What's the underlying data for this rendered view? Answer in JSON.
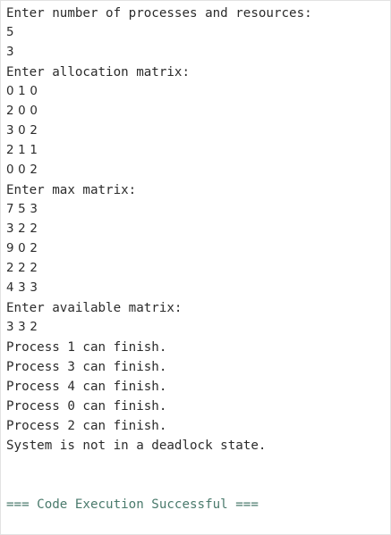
{
  "output": {
    "lines": [
      {
        "text": "Enter number of processes and resources:",
        "kind": "prompt"
      },
      {
        "text": "5",
        "kind": "nums"
      },
      {
        "text": "3",
        "kind": "nums"
      },
      {
        "text": "Enter allocation matrix:",
        "kind": "prompt"
      },
      {
        "text": "0 1 0",
        "kind": "nums"
      },
      {
        "text": "2 0 0",
        "kind": "nums"
      },
      {
        "text": "3 0 2",
        "kind": "nums"
      },
      {
        "text": "2 1 1",
        "kind": "nums"
      },
      {
        "text": "0 0 2",
        "kind": "nums"
      },
      {
        "text": "Enter max matrix:",
        "kind": "prompt"
      },
      {
        "text": "7 5 3",
        "kind": "nums"
      },
      {
        "text": "3 2 2",
        "kind": "nums"
      },
      {
        "text": "9 0 2",
        "kind": "nums"
      },
      {
        "text": "2 2 2",
        "kind": "nums"
      },
      {
        "text": "4 3 3",
        "kind": "nums"
      },
      {
        "text": "Enter available matrix:",
        "kind": "prompt"
      },
      {
        "text": "3 3 2",
        "kind": "nums"
      },
      {
        "text": "Process 1 can finish.",
        "kind": "prompt"
      },
      {
        "text": "Process 3 can finish.",
        "kind": "prompt"
      },
      {
        "text": "Process 4 can finish.",
        "kind": "prompt"
      },
      {
        "text": "Process 0 can finish.",
        "kind": "prompt"
      },
      {
        "text": "Process 2 can finish.",
        "kind": "prompt"
      },
      {
        "text": "System is not in a deadlock state.",
        "kind": "prompt"
      }
    ],
    "status": "=== Code Execution Successful ===",
    "status_color": "#4a7a6c",
    "text_color": "#2b2b2b"
  }
}
